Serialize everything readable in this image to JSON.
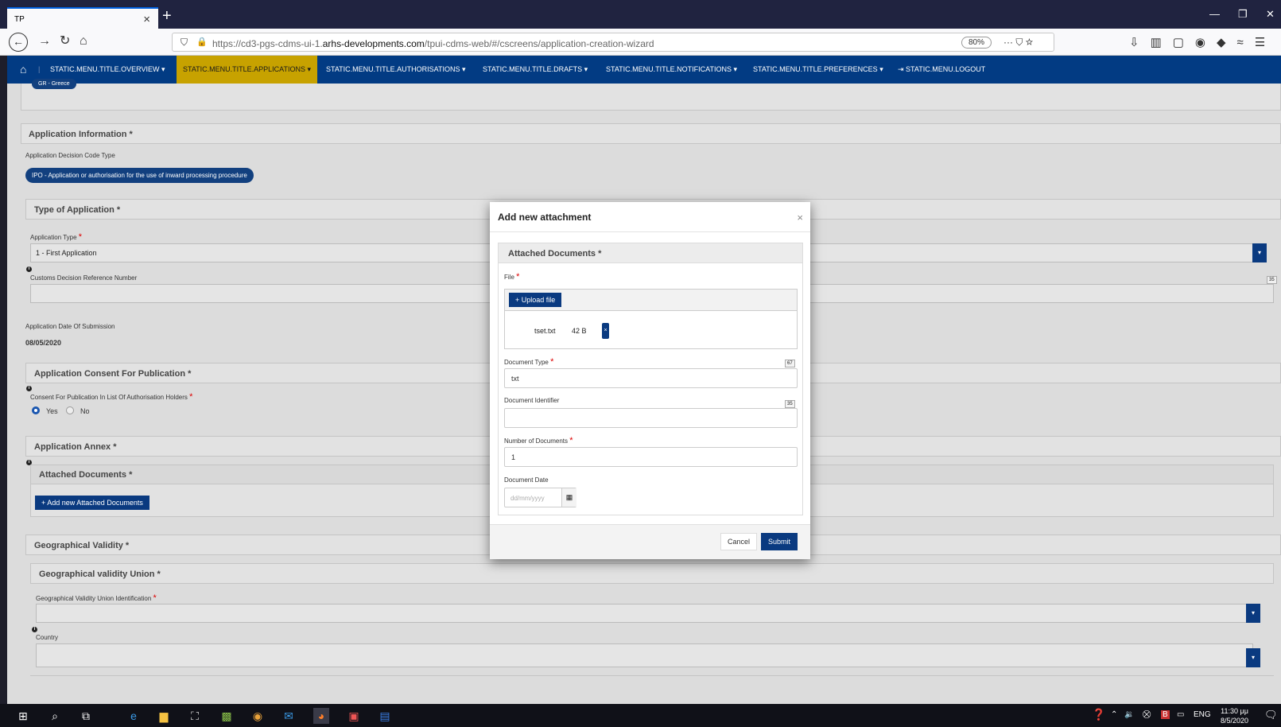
{
  "browser": {
    "tab_title": "TP",
    "tab_close": "×",
    "new_tab": "+",
    "url_prefix": "https://cd3-pgs-cdms-ui-1.",
    "url_domain": "arhs-developments.com",
    "url_path": "/tpui-cdms-web/#/cscreens/application-creation-wizard",
    "zoom": "80%",
    "page_actions": "··· ⛉ ☆"
  },
  "menu": {
    "items": [
      "STATIC.MENU.TITLE.OVERVIEW",
      "STATIC.MENU.TITLE.APPLICATIONS",
      "STATIC.MENU.TITLE.AUTHORISATIONS",
      "STATIC.MENU.TITLE.DRAFTS",
      "STATIC.MENU.TITLE.NOTIFICATIONS",
      "STATIC.MENU.TITLE.PREFERENCES"
    ],
    "logout": "STATIC.MENU.LOGOUT",
    "active_color": "#c7a200",
    "bar_color": "#023b83"
  },
  "page": {
    "gr_chip": "GR - Greece",
    "app_info_title": "Application Information *",
    "decision_code_label": "Application Decision Code Type",
    "decision_code_value": "IPO - Application or authorisation for the use of inward processing procedure",
    "type_title": "Type of Application *",
    "app_type_label": "Application Type",
    "app_type_value": "1 - First Application",
    "customs_ref_label": "Customs Decision Reference Number",
    "customs_ref_counter": "35",
    "submission_label": "Application Date Of Submission",
    "submission_value": "08/05/2020",
    "consent_title": "Application Consent For Publication *",
    "consent_label": "Consent For Publication In List Of Authorisation Holders",
    "yes": "Yes",
    "no": "No",
    "annex_title": "Application Annex *",
    "attached_title": "Attached Documents *",
    "add_attached": "+ Add new Attached Documents",
    "geo_title": "Geographical Validity *",
    "geo_union_title": "Geographical validity Union *",
    "geo_union_label": "Geographical Validity Union Identification",
    "country_label": "Country",
    "req": "*"
  },
  "modal": {
    "title": "Add new attachment",
    "close": "×",
    "panel_title": "Attached Documents *",
    "file_label": "File",
    "upload": "+ Upload file",
    "file_name": "tset.txt",
    "file_size": "42 B",
    "file_remove": "×",
    "doc_type_label": "Document Type",
    "doc_type_value": "txt",
    "doc_type_counter": "67",
    "doc_id_label": "Document Identifier",
    "doc_id_counter": "35",
    "num_docs_label": "Number of Documents",
    "num_docs_value": "1",
    "doc_date_label": "Document Date",
    "doc_date_placeholder": "dd/mm/yyyy",
    "cancel": "Cancel",
    "submit": "Submit",
    "submit_color": "#0a3a80"
  },
  "taskbar": {
    "lang": "ENG",
    "time": "11:30 μμ",
    "date": "8/5/2020"
  }
}
